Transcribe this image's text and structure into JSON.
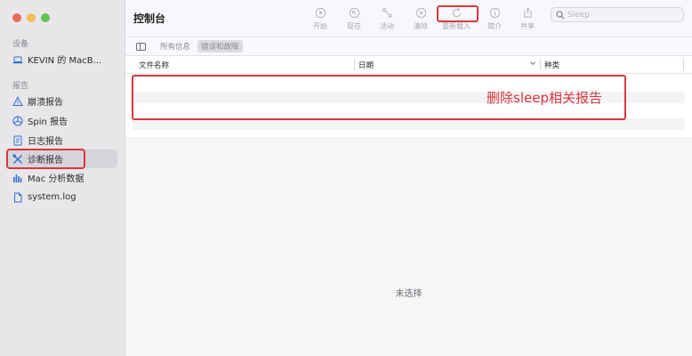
{
  "window": {
    "title": "控制台"
  },
  "sidebar": {
    "devices_label": "设备",
    "device_name": "KEVIN 的 MacB...",
    "reports_label": "报告",
    "items": [
      {
        "label": "崩溃报告",
        "icon": "warning-triangle-icon"
      },
      {
        "label": "Spin 报告",
        "icon": "spin-icon"
      },
      {
        "label": "日志报告",
        "icon": "document-icon"
      },
      {
        "label": "诊断报告",
        "icon": "tools-icon",
        "selected": true
      },
      {
        "label": "Mac 分析数据",
        "icon": "bar-chart-icon"
      },
      {
        "label": "system.log",
        "icon": "file-icon"
      }
    ]
  },
  "toolbar": {
    "start": "开始",
    "now": "现在",
    "activity": "活动",
    "clear": "清除",
    "reload": "重新载入",
    "info": "简介",
    "share": "共享"
  },
  "search": {
    "value": "",
    "placeholder": "Sleep"
  },
  "filters": {
    "all": "所有信息",
    "errors": "错误和故障"
  },
  "table": {
    "columns": [
      "文件名称",
      "日期",
      "种类"
    ]
  },
  "annotation": "删除sleep相关报告",
  "detail": {
    "empty_text": "未选择"
  },
  "colors": {
    "accent": "#2f6fd6",
    "highlight": "#d9363e"
  }
}
